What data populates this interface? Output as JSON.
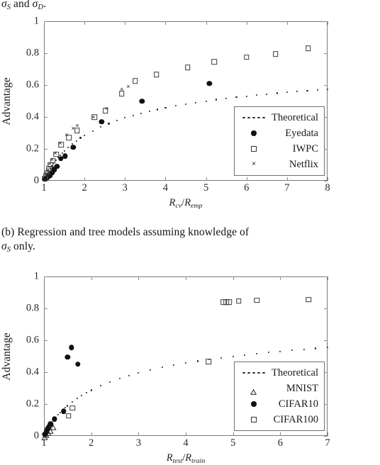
{
  "captions": {
    "top": {
      "line1_pre": "",
      "sigma_s": "σ",
      "sub_s": "S",
      "and": " and ",
      "sigma_d": "σ",
      "sub_d": "D",
      "period": ".",
      "plain": "σS and σD."
    },
    "middle": {
      "label": "(b)",
      "line1": "(b) Regression and tree models assuming knowledge of",
      "line2_sigma": "σ",
      "line2_sub": "S",
      "line2_rest": " only.",
      "plain": "(b) Regression and tree models assuming knowledge of σS only."
    }
  },
  "chart_data": [
    {
      "id": "chart-a",
      "type": "scatter",
      "title": "",
      "xlabel": "R_cv/R_emp",
      "xlabel_parts": {
        "num": "R",
        "num_sub": "cv",
        "den": "R",
        "den_sub": "emp",
        "slash": "/"
      },
      "ylabel": "Advantage",
      "xlim": [
        1,
        8
      ],
      "ylim": [
        0,
        1
      ],
      "xticks": [
        1,
        2,
        3,
        4,
        5,
        6,
        7,
        8
      ],
      "xticklabels": [
        "1",
        "2",
        "3",
        "4",
        "5",
        "6",
        "7",
        "8"
      ],
      "yticks": [
        0,
        0.2,
        0.4,
        0.6,
        0.8,
        1
      ],
      "yticklabels": [
        "0",
        "0.2",
        "0.4",
        "0.6",
        "0.8",
        "1"
      ],
      "grid": false,
      "legend_position": "lower right",
      "series": [
        {
          "name": "Theoretical",
          "marker": "dotted-line",
          "points": [
            [
              1.0,
              0.005
            ],
            [
              1.05,
              0.03
            ],
            [
              1.1,
              0.055
            ],
            [
              1.15,
              0.075
            ],
            [
              1.2,
              0.095
            ],
            [
              1.25,
              0.113
            ],
            [
              1.3,
              0.13
            ],
            [
              1.35,
              0.145
            ],
            [
              1.4,
              0.16
            ],
            [
              1.45,
              0.173
            ],
            [
              1.5,
              0.186
            ],
            [
              1.6,
              0.21
            ],
            [
              1.7,
              0.232
            ],
            [
              1.8,
              0.251
            ],
            [
              1.9,
              0.269
            ],
            [
              2.0,
              0.285
            ],
            [
              2.2,
              0.313
            ],
            [
              2.4,
              0.337
            ],
            [
              2.6,
              0.358
            ],
            [
              2.8,
              0.377
            ],
            [
              3.0,
              0.394
            ],
            [
              3.2,
              0.409
            ],
            [
              3.4,
              0.423
            ],
            [
              3.6,
              0.436
            ],
            [
              3.8,
              0.447
            ],
            [
              4.0,
              0.458
            ],
            [
              4.25,
              0.47
            ],
            [
              4.5,
              0.481
            ],
            [
              4.75,
              0.491
            ],
            [
              5.0,
              0.5
            ],
            [
              5.25,
              0.509
            ],
            [
              5.5,
              0.516
            ],
            [
              5.75,
              0.524
            ],
            [
              6.0,
              0.531
            ],
            [
              6.25,
              0.537
            ],
            [
              6.5,
              0.543
            ],
            [
              6.75,
              0.549
            ],
            [
              7.0,
              0.554
            ],
            [
              7.25,
              0.559
            ],
            [
              7.5,
              0.564
            ],
            [
              7.75,
              0.569
            ],
            [
              8.0,
              0.573
            ]
          ]
        },
        {
          "name": "Eyedata",
          "marker": "filled-circle",
          "points": [
            [
              1.02,
              0.01
            ],
            [
              1.05,
              0.015
            ],
            [
              1.08,
              0.02
            ],
            [
              1.12,
              0.03
            ],
            [
              1.15,
              0.035
            ],
            [
              1.2,
              0.05
            ],
            [
              1.25,
              0.07
            ],
            [
              1.32,
              0.09
            ],
            [
              1.42,
              0.14
            ],
            [
              1.52,
              0.155
            ],
            [
              1.72,
              0.21
            ],
            [
              2.42,
              0.37
            ],
            [
              3.42,
              0.5
            ],
            [
              5.08,
              0.61
            ]
          ]
        },
        {
          "name": "IWPC",
          "marker": "open-square",
          "points": [
            [
              1.02,
              0.015
            ],
            [
              1.05,
              0.03
            ],
            [
              1.08,
              0.05
            ],
            [
              1.12,
              0.075
            ],
            [
              1.16,
              0.1
            ],
            [
              1.22,
              0.125
            ],
            [
              1.3,
              0.165
            ],
            [
              1.42,
              0.225
            ],
            [
              1.62,
              0.27
            ],
            [
              1.82,
              0.315
            ],
            [
              2.25,
              0.4
            ],
            [
              2.52,
              0.44
            ],
            [
              2.92,
              0.545
            ],
            [
              3.25,
              0.625
            ],
            [
              3.78,
              0.665
            ],
            [
              4.55,
              0.71
            ],
            [
              5.2,
              0.745
            ],
            [
              6.0,
              0.775
            ],
            [
              6.72,
              0.795
            ],
            [
              7.52,
              0.83
            ]
          ]
        },
        {
          "name": "Netflix",
          "marker": "cross",
          "points": [
            [
              1.03,
              0.02
            ],
            [
              1.07,
              0.045
            ],
            [
              1.1,
              0.07
            ],
            [
              1.14,
              0.105
            ],
            [
              1.2,
              0.135
            ],
            [
              1.28,
              0.175
            ],
            [
              1.4,
              0.235
            ],
            [
              1.56,
              0.29
            ],
            [
              1.72,
              0.33
            ],
            [
              1.82,
              0.345
            ],
            [
              2.22,
              0.4
            ],
            [
              2.55,
              0.455
            ],
            [
              2.92,
              0.575
            ],
            [
              3.08,
              0.59
            ]
          ]
        }
      ],
      "legend": [
        {
          "label": "Theoretical",
          "marker": "dotted-line"
        },
        {
          "label": "Eyedata",
          "marker": "filled-circle"
        },
        {
          "label": "IWPC",
          "marker": "open-square"
        },
        {
          "label": "Netflix",
          "marker": "cross"
        }
      ]
    },
    {
      "id": "chart-b",
      "type": "scatter",
      "title": "",
      "xlabel": "R_test/R_train",
      "xlabel_parts": {
        "num": "R",
        "num_sub": "test",
        "den": "R",
        "den_sub": "train",
        "slash": "/"
      },
      "ylabel": "Advantage",
      "xlim": [
        1,
        7
      ],
      "ylim": [
        0,
        1
      ],
      "xticks": [
        1,
        2,
        3,
        4,
        5,
        6,
        7
      ],
      "xticklabels": [
        "1",
        "2",
        "3",
        "4",
        "5",
        "6",
        "7"
      ],
      "yticks": [
        0,
        0.2,
        0.4,
        0.6,
        0.8,
        1
      ],
      "yticklabels": [
        "0",
        "0.2",
        "0.4",
        "0.6",
        "0.8",
        "1"
      ],
      "grid": false,
      "legend_position": "lower right",
      "series": [
        {
          "name": "Theoretical",
          "marker": "dotted-line",
          "points": [
            [
              1.0,
              0.005
            ],
            [
              1.05,
              0.03
            ],
            [
              1.1,
              0.055
            ],
            [
              1.15,
              0.078
            ],
            [
              1.2,
              0.098
            ],
            [
              1.25,
              0.115
            ],
            [
              1.3,
              0.132
            ],
            [
              1.35,
              0.148
            ],
            [
              1.4,
              0.162
            ],
            [
              1.45,
              0.176
            ],
            [
              1.5,
              0.189
            ],
            [
              1.6,
              0.212
            ],
            [
              1.7,
              0.234
            ],
            [
              1.8,
              0.253
            ],
            [
              1.9,
              0.271
            ],
            [
              2.0,
              0.287
            ],
            [
              2.2,
              0.315
            ],
            [
              2.4,
              0.339
            ],
            [
              2.6,
              0.36
            ],
            [
              2.8,
              0.379
            ],
            [
              3.0,
              0.396
            ],
            [
              3.25,
              0.414
            ],
            [
              3.5,
              0.43
            ],
            [
              3.75,
              0.444
            ],
            [
              4.0,
              0.457
            ],
            [
              4.25,
              0.469
            ],
            [
              4.5,
              0.48
            ],
            [
              4.75,
              0.49
            ],
            [
              5.0,
              0.499
            ],
            [
              5.25,
              0.508
            ],
            [
              5.5,
              0.516
            ],
            [
              5.75,
              0.523
            ],
            [
              6.0,
              0.53
            ],
            [
              6.25,
              0.537
            ],
            [
              6.5,
              0.543
            ],
            [
              6.75,
              0.549
            ],
            [
              7.0,
              0.554
            ]
          ]
        },
        {
          "name": "MNIST",
          "marker": "open-triangle",
          "points": [
            [
              1.02,
              0.015
            ],
            [
              1.05,
              0.025
            ],
            [
              1.09,
              0.04
            ],
            [
              1.13,
              0.055
            ],
            [
              1.2,
              0.075
            ]
          ]
        },
        {
          "name": "CIFAR10",
          "marker": "filled-circle",
          "points": [
            [
              1.02,
              0.01
            ],
            [
              1.04,
              0.02
            ],
            [
              1.06,
              0.03
            ],
            [
              1.08,
              0.045
            ],
            [
              1.1,
              0.06
            ],
            [
              1.14,
              0.075
            ],
            [
              1.22,
              0.105
            ],
            [
              1.42,
              0.155
            ],
            [
              1.58,
              0.555
            ],
            [
              1.5,
              0.495
            ],
            [
              1.72,
              0.45
            ]
          ]
        },
        {
          "name": "CIFAR100",
          "marker": "open-square",
          "points": [
            [
              1.6,
              0.175
            ],
            [
              1.52,
              0.125
            ],
            [
              4.48,
              0.465
            ],
            [
              4.8,
              0.84
            ],
            [
              4.86,
              0.84
            ],
            [
              4.92,
              0.84
            ],
            [
              5.12,
              0.845
            ],
            [
              5.5,
              0.85
            ],
            [
              6.6,
              0.855
            ]
          ]
        }
      ],
      "legend": [
        {
          "label": "Theoretical",
          "marker": "dotted-line"
        },
        {
          "label": "MNIST",
          "marker": "open-triangle"
        },
        {
          "label": "CIFAR10",
          "marker": "filled-circle"
        },
        {
          "label": "CIFAR100",
          "marker": "open-square"
        }
      ]
    }
  ]
}
